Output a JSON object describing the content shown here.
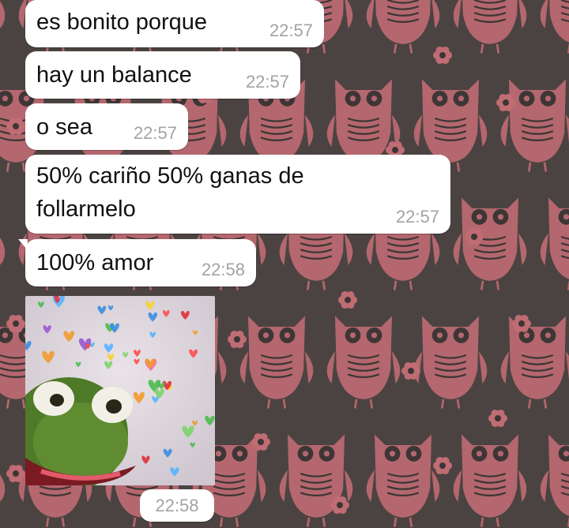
{
  "chat": {
    "messages": [
      {
        "text": "es bonito porque",
        "time": "22:57"
      },
      {
        "text": "hay un balance",
        "time": "22:57"
      },
      {
        "text": "o sea",
        "time": "22:57"
      },
      {
        "text": "50% cariño 50% ganas de\nfollarmelo",
        "time": "22:57"
      },
      {
        "text": "100% amor",
        "time": "22:58"
      }
    ],
    "media": {
      "icon": "kermit-hearts-sticker-icon",
      "time": "22:58"
    }
  },
  "colors": {
    "wallpaper_bg": "#4b4342",
    "owl_pink": "#c06c73",
    "bubble_bg": "#ffffff",
    "text": "#111111",
    "timestamp": "#a3a3a3"
  }
}
